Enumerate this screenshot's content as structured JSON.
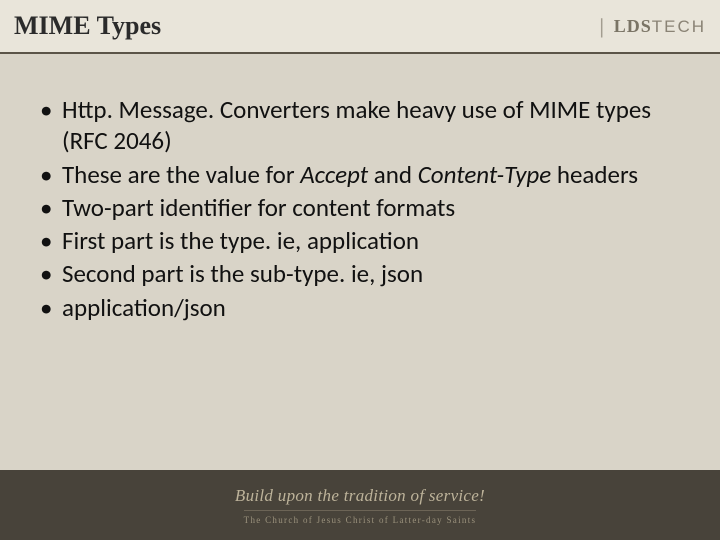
{
  "title": "MIME Types",
  "brand": {
    "lds": "LDS",
    "tech": "TECH"
  },
  "bullets": [
    {
      "html": "Http. Message. Converters make heavy use of MIME types (RFC 2046)"
    },
    {
      "html": "These are the value for <em>Accept</em> and <em>Content-Type</em> headers"
    },
    {
      "html": "Two-part identifier for content formats"
    },
    {
      "html": "First part is the type. ie, application"
    },
    {
      "html": "Second part is the sub-type. ie, json"
    },
    {
      "html": "application/json"
    }
  ],
  "footer": {
    "tagline": "Build upon the tradition of service!",
    "org": "The Church of Jesus Christ of Latter-day Saints"
  }
}
